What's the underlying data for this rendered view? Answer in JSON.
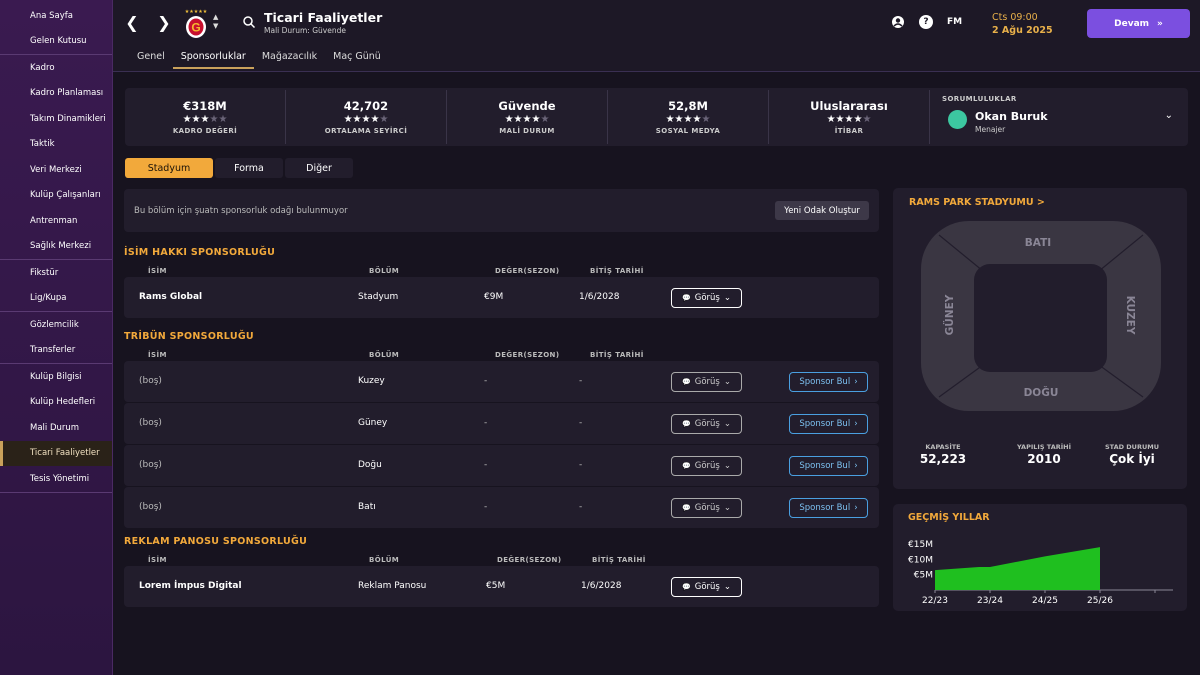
{
  "sidebar": {
    "groups": [
      [
        "Ana Sayfa",
        "Gelen Kutusu"
      ],
      [
        "Kadro",
        "Kadro Planlaması",
        "Takım Dinamikleri",
        "Taktik",
        "Veri Merkezi",
        "Kulüp Çalışanları",
        "Antrenman",
        "Sağlık Merkezi"
      ],
      [
        "Fikstür",
        "Lig/Kupa"
      ],
      [
        "Gözlemcilik",
        "Transferler"
      ],
      [
        "Kulüp Bilgisi",
        "Kulüp Hedefleri",
        "Mali Durum",
        "Ticari Faaliyetler",
        "Tesis Yönetimi"
      ]
    ],
    "active": "Ticari Faaliyetler"
  },
  "header": {
    "title": "Ticari Faaliyetler",
    "subtitle": "Mali Durum: Güvende",
    "tabs": [
      "Genel",
      "Sponsorluklar",
      "Mağazacılık",
      "Maç Günü"
    ],
    "active_tab": "Sponsorluklar",
    "fm_label": "FM",
    "help_label": "?",
    "date_line1": "Cts 09:00",
    "date_line2": "2 Ağu 2025",
    "continue_label": "Devam",
    "accent": "#7b4fe0"
  },
  "stats": [
    {
      "value": "€318M",
      "stars": 3,
      "label": "KADRO DEĞERİ"
    },
    {
      "value": "42,702",
      "stars": 4,
      "label": "ORTALAMA SEYİRCİ"
    },
    {
      "value": "Güvende",
      "stars": 4,
      "label": "MALİ DURUM"
    },
    {
      "value": "52,8M",
      "stars": 4,
      "label": "SOSYAL MEDYA"
    },
    {
      "value": "Uluslararası",
      "stars": 4,
      "label": "İTİBAR"
    }
  ],
  "responsibilities": {
    "label": "SORUMLULUKLAR",
    "name": "Okan Buruk",
    "role": "Menajer"
  },
  "subtabs": [
    "Stadyum",
    "Forma",
    "Diğer"
  ],
  "active_subtab": "Stadyum",
  "empty_focus": {
    "text": "Bu bölüm için şuatn sponsorluk odağı bulunmuyor",
    "button": "Yeni Odak Oluştur"
  },
  "columns": {
    "name": "İSİM",
    "section": "BÖLÜM",
    "value": "DEĞER(SEZON)",
    "end": "BİTİŞ TARİHİ"
  },
  "gorus_label": "Görüş",
  "find_label": "Sponsor Bul",
  "sections": [
    {
      "title": "İSİM HAKKI SPONSORLUĞU",
      "rows": [
        {
          "name": "Rams Global",
          "section": "Stadyum",
          "value": "€9M",
          "end": "1/6/2028",
          "empty": false
        }
      ]
    },
    {
      "title": "TRİBÜN SPONSORLUĞU",
      "rows": [
        {
          "name": "(boş)",
          "section": "Kuzey",
          "value": "-",
          "end": "-",
          "empty": true
        },
        {
          "name": "(boş)",
          "section": "Güney",
          "value": "-",
          "end": "-",
          "empty": true
        },
        {
          "name": "(boş)",
          "section": "Doğu",
          "value": "-",
          "end": "-",
          "empty": true
        },
        {
          "name": "(boş)",
          "section": "Batı",
          "value": "-",
          "end": "-",
          "empty": true
        }
      ]
    },
    {
      "title": "REKLAM PANOSU SPONSORLUĞU",
      "rows": [
        {
          "name": "Lorem İmpus Digital",
          "section": "Reklam Panosu",
          "value": "€5M",
          "end": "1/6/2028",
          "empty": false
        }
      ]
    }
  ],
  "stadium": {
    "title": "RAMS PARK STADYUMU >",
    "stands": {
      "north": "BATI",
      "south": "DOĞU",
      "west": "GÜNEY",
      "east": "KUZEY"
    },
    "capacity_label": "KAPASİTE",
    "capacity": "52,223",
    "built_label": "YAPILIŞ TARİHİ",
    "built": "2010",
    "status_label": "STAD DURUMU",
    "status": "Çok İyi"
  },
  "history": {
    "title": "GEÇMİŞ YILLAR"
  },
  "chart_data": {
    "type": "area",
    "title": "GEÇMİŞ YILLAR",
    "categories": [
      "22/23",
      "23/24",
      "24/25",
      "25/26"
    ],
    "y_tick_labels": [
      "€15M",
      "€10M",
      "€5M"
    ],
    "y_ticks": [
      15,
      10,
      5
    ],
    "ylim": [
      0,
      17
    ],
    "x": [
      0,
      0.8,
      1,
      2,
      3
    ],
    "values": [
      6.5,
      7.5,
      7.5,
      11,
      14
    ],
    "color": "#1fbf1f"
  }
}
